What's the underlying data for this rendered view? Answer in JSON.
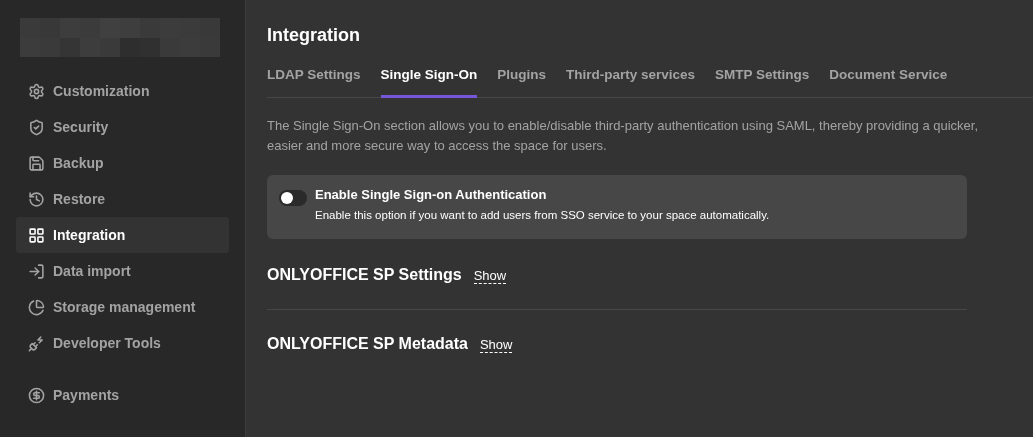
{
  "sidebar": {
    "items": [
      {
        "label": "Customization",
        "selected": false
      },
      {
        "label": "Security",
        "selected": false
      },
      {
        "label": "Backup",
        "selected": false
      },
      {
        "label": "Restore",
        "selected": false
      },
      {
        "label": "Integration",
        "selected": true
      },
      {
        "label": "Data import",
        "selected": false
      },
      {
        "label": "Storage management",
        "selected": false
      },
      {
        "label": "Developer Tools",
        "selected": false
      },
      {
        "label": "Payments",
        "selected": false
      }
    ]
  },
  "page_title": "Integration",
  "tabs": [
    {
      "label": "LDAP Settings",
      "selected": false
    },
    {
      "label": "Single Sign-On",
      "selected": true
    },
    {
      "label": "Plugins",
      "selected": false
    },
    {
      "label": "Third-party services",
      "selected": false
    },
    {
      "label": "SMTP Settings",
      "selected": false
    },
    {
      "label": "Document Service",
      "selected": false
    }
  ],
  "description": "The Single Sign-On section allows you to enable/disable third-party authentication using SAML, thereby providing a quicker, easier and more secure way to access the space for users.",
  "sso_toggle": {
    "label": "Enable Single Sign-on Authentication",
    "hint": "Enable this option if you want to add users from SSO service to your space automatically.",
    "on": false
  },
  "sections": [
    {
      "title": "ONLYOFFICE SP Settings",
      "link": "Show"
    },
    {
      "title": "ONLYOFFICE SP Metadata",
      "link": "Show"
    }
  ]
}
